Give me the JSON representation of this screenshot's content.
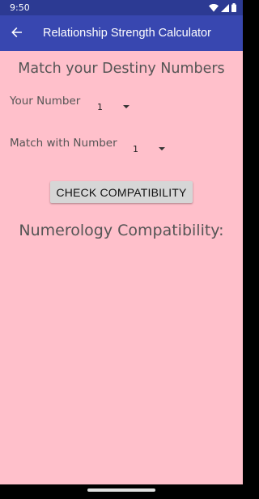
{
  "status_bar": {
    "time": "9:50",
    "icons": [
      "wifi-icon",
      "cellular-icon",
      "battery-icon"
    ]
  },
  "app_bar": {
    "title": "Relationship Strength Calculator",
    "back_icon": "arrow-back-icon"
  },
  "main": {
    "heading": "Match your Destiny Numbers",
    "your_number": {
      "label": "Your Number",
      "selected": "1"
    },
    "match_number": {
      "label": "Match with Number",
      "selected": "1"
    },
    "check_button_label": "CHECK COMPATIBILITY",
    "result_heading": "Numerology Compatibility:"
  },
  "colors": {
    "status_bar": "#2c3a93",
    "app_bar": "#3847b0",
    "background": "#ffc0cb",
    "button": "#d6d6d6",
    "text": "#555555"
  }
}
